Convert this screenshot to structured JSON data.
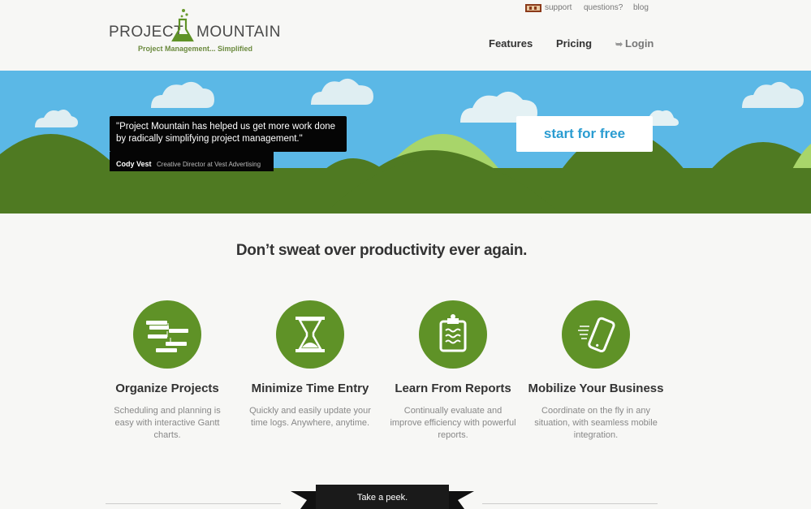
{
  "header": {
    "logo_left": "PROJECT",
    "logo_right": "MOUNTAIN",
    "logo_tagline": "Project Management... Simplified",
    "top_links": {
      "support": "support",
      "questions": "questions?",
      "blog": "blog"
    },
    "nav": {
      "features": "Features",
      "pricing": "Pricing",
      "login": "Login"
    }
  },
  "hero": {
    "quote": "\"Project Mountain has helped us get more work done by radically simplifying project management.\"",
    "author_name": "Cody Vest",
    "author_role": "Creative Director at Vest Advertising",
    "cta_label": "start for free"
  },
  "main": {
    "tagline": "Don’t sweat over productivity ever again.",
    "features": [
      {
        "title": "Organize Projects",
        "description": "Scheduling and planning is easy with interactive Gantt charts.",
        "icon": "gantt-icon"
      },
      {
        "title": "Minimize Time Entry",
        "description": "Quickly and easily update your time logs. Anywhere, anytime.",
        "icon": "hourglass-icon"
      },
      {
        "title": "Learn From Reports",
        "description": "Continually evaluate and improve efficiency with powerful reports.",
        "icon": "clipboard-icon"
      },
      {
        "title": "Mobilize Your Business",
        "description": "Coordinate on the fly in any situation, with seamless mobile integration.",
        "icon": "phone-icon"
      }
    ],
    "peek_label": "Take a peek."
  },
  "colors": {
    "sky": "#5bb8e6",
    "mountain_dark": "#4f7a22",
    "mountain_light": "#a8d56a",
    "feature_green": "#5f9227",
    "cta_text": "#2a9cd1"
  }
}
